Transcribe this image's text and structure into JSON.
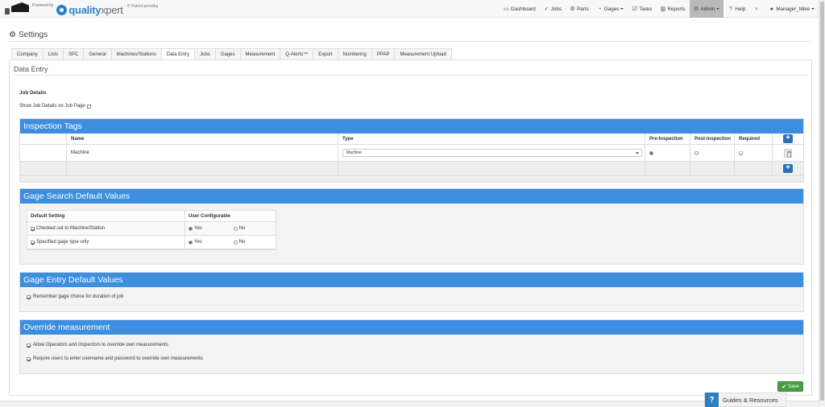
{
  "brand": {
    "powered_by": "Powered by",
    "logo_text_a": "quality",
    "logo_text_b": "xpert",
    "patent": "® Patent pending"
  },
  "nav": [
    {
      "label": "Dashboard",
      "icon": "monitor-icon",
      "glyph": "▭"
    },
    {
      "label": "Jobs",
      "icon": "check-icon",
      "glyph": "✓"
    },
    {
      "label": "Parts",
      "icon": "cogs-icon",
      "glyph": "⚙"
    },
    {
      "label": "Gages",
      "icon": "dashboard-icon",
      "glyph": "◔",
      "dropdown": true
    },
    {
      "label": "Tasks",
      "icon": "checkbox-icon",
      "glyph": "☑"
    },
    {
      "label": "Reports",
      "icon": "bar-chart-icon",
      "glyph": "▥"
    },
    {
      "label": "Admin",
      "icon": "gear-icon",
      "glyph": "⚙",
      "dropdown": true,
      "active": true
    },
    {
      "label": "Help",
      "icon": "question-icon",
      "glyph": "?"
    },
    {
      "label": "",
      "icon": "lightbulb-icon",
      "glyph": "♀"
    },
    {
      "label": "Manager_Mike",
      "icon": "user-icon",
      "glyph": "●",
      "dropdown": true
    }
  ],
  "page_title": "Settings",
  "tabs": [
    "Company",
    "Lists",
    "SPC",
    "General",
    "Machines/Stations",
    "Data Entry",
    "Jobs",
    "Gages",
    "Measurement",
    "Q-Alerts™",
    "Export",
    "Numbering",
    "PPAP",
    "Measurement Upload"
  ],
  "active_tab": "Data Entry",
  "panel_title": "Data Entry",
  "job_details": {
    "heading": "Job Details",
    "show_label": "Show Job Details on Job Page"
  },
  "inspection_tags": {
    "title": "Inspection Tags",
    "columns": [
      "",
      "Name",
      "Type",
      "Pre-Inspection",
      "Post-Inspection",
      "Required"
    ],
    "rows": [
      {
        "name": "Machine",
        "type": "Machine",
        "pre": true,
        "post": false,
        "required": true
      }
    ]
  },
  "gage_search": {
    "title": "Gage Search Default Values",
    "columns": [
      "Default Setting",
      "User Configurable"
    ],
    "rows": [
      {
        "label": "Checked out to Machine/Station",
        "checked": true,
        "yes": "Yes",
        "no": "No",
        "value": "yes"
      },
      {
        "label": "Specified gage type only",
        "checked": true,
        "yes": "Yes",
        "no": "No",
        "value": "yes"
      }
    ]
  },
  "gage_entry": {
    "title": "Gage Entry Default Values",
    "items": [
      {
        "label": "Remember gage choice for duration of job",
        "checked": true
      }
    ]
  },
  "override": {
    "title": "Override measurement",
    "items": [
      {
        "label": "Allow Operators and Inspectors to override own measurements",
        "checked": true
      },
      {
        "label": "Require users to enter username and password to override own measurements",
        "checked": true
      }
    ]
  },
  "save_label": "Save",
  "guides_label": "Guides & Resources",
  "colors": {
    "section_header": "#3d8ede",
    "save": "#4a9d44",
    "accent": "#2e7fc2"
  }
}
